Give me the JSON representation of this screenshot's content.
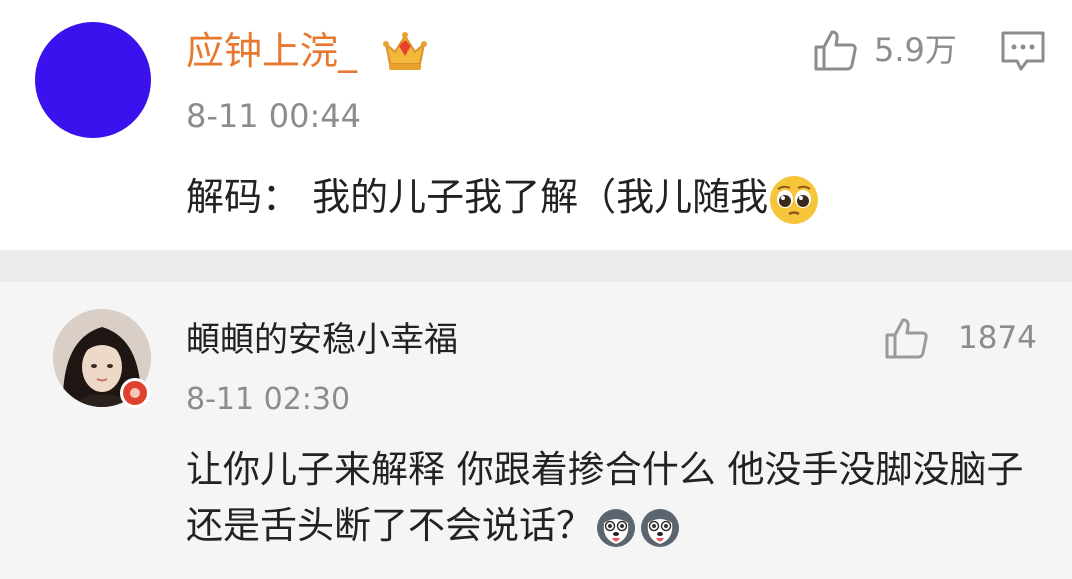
{
  "comment": {
    "author": "应钟上浣_",
    "time": "8-11 00:44",
    "text": "解码： 我的儿子我了解（我儿随我",
    "like_count": "5.9万",
    "badge_icon": "crown-gem-icon",
    "emoji": "pleading-face-icon",
    "author_color": "#e8782e",
    "avatar_color": "#3b12ee"
  },
  "reply": {
    "author": "頔頔的安稳小幸福",
    "time": "8-11 02:30",
    "text": "让你儿子来解释 你跟着掺合什么 他没手没脚没脑子还是舌头断了不会说话？",
    "like_count": "1874",
    "emoji": "husky-icon",
    "emoji_count": 2
  }
}
